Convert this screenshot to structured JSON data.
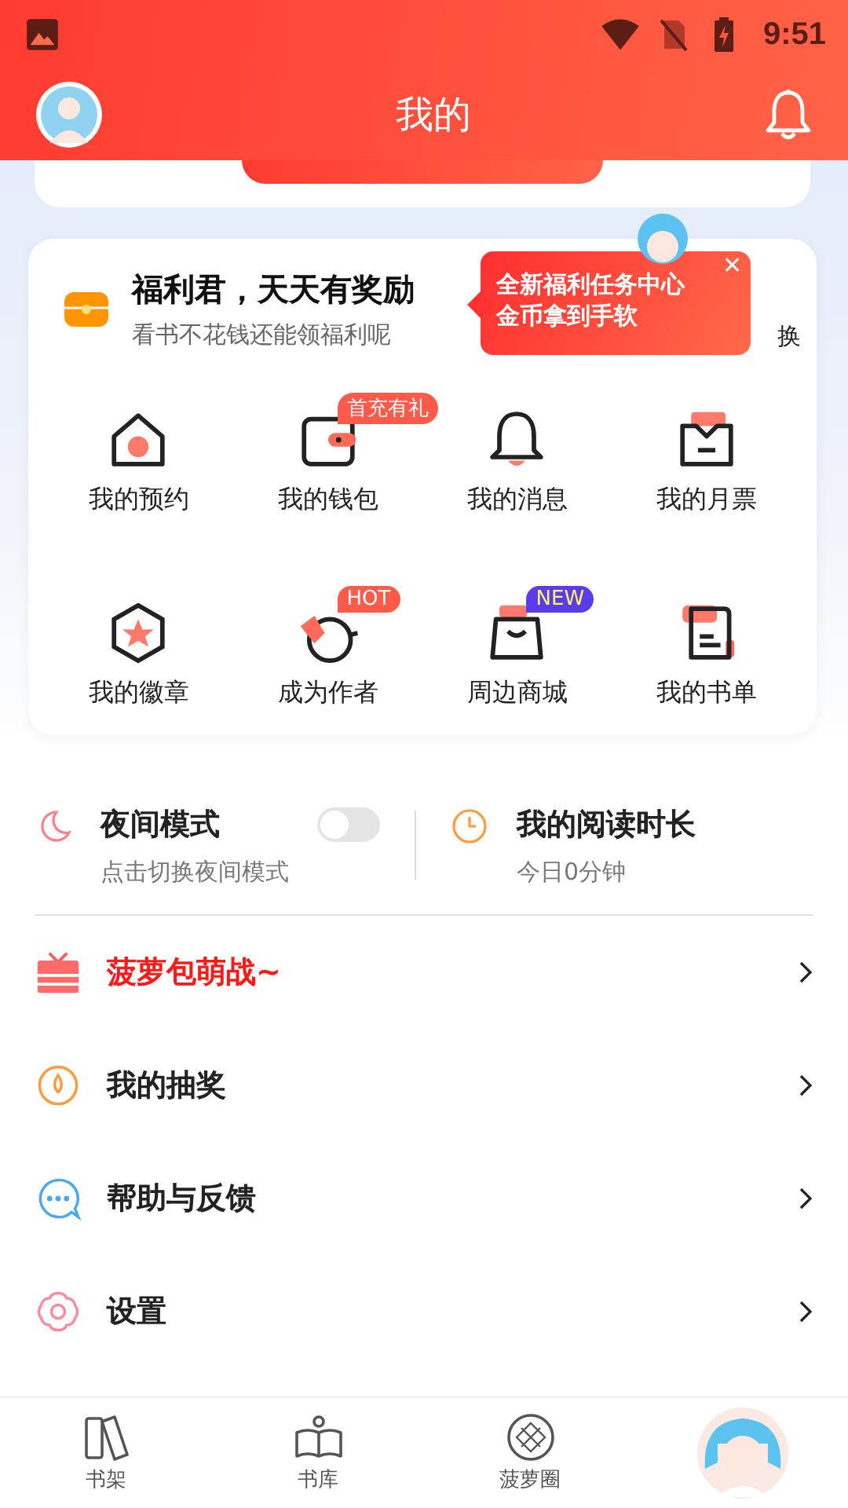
{
  "status_bar": {
    "time": "9:51"
  },
  "header": {
    "title": "我的"
  },
  "welfare": {
    "title": "福利君，天天有奖励",
    "subtitle": "看书不花钱还能领福利呢",
    "side_text": "换",
    "tooltip": {
      "lines": [
        "全新福利任务中心",
        "金币拿到手软"
      ],
      "close": "✕"
    }
  },
  "grid": [
    {
      "label": "我的预约"
    },
    {
      "label": "我的钱包",
      "badge": "首充有礼",
      "color": "#ff5a4a"
    },
    {
      "label": "我的消息"
    },
    {
      "label": "我的月票"
    },
    {
      "label": "我的徽章"
    },
    {
      "label": "成为作者",
      "badge": "HOT",
      "color": "#ff5a4a"
    },
    {
      "label": "周边商城",
      "badge": "NEW",
      "color": "#5a3de8"
    },
    {
      "label": "我的书单"
    }
  ],
  "night_mode": {
    "title": "夜间模式",
    "subtitle": "点击切换夜间模式",
    "on": false
  },
  "reading_time": {
    "title": "我的阅读时长",
    "subtitle": "今日0分钟"
  },
  "menu": [
    {
      "label": "菠萝包萌战~",
      "highlight": true
    },
    {
      "label": "我的抽奖",
      "highlight": false
    },
    {
      "label": "帮助与反馈",
      "highlight": false
    },
    {
      "label": "设置",
      "highlight": false
    }
  ],
  "bottom_nav": [
    {
      "kind": "icon",
      "label": "书架"
    },
    {
      "kind": "icon",
      "label": "书库"
    },
    {
      "kind": "icon",
      "label": "菠萝圈"
    },
    {
      "kind": "avatar"
    }
  ]
}
